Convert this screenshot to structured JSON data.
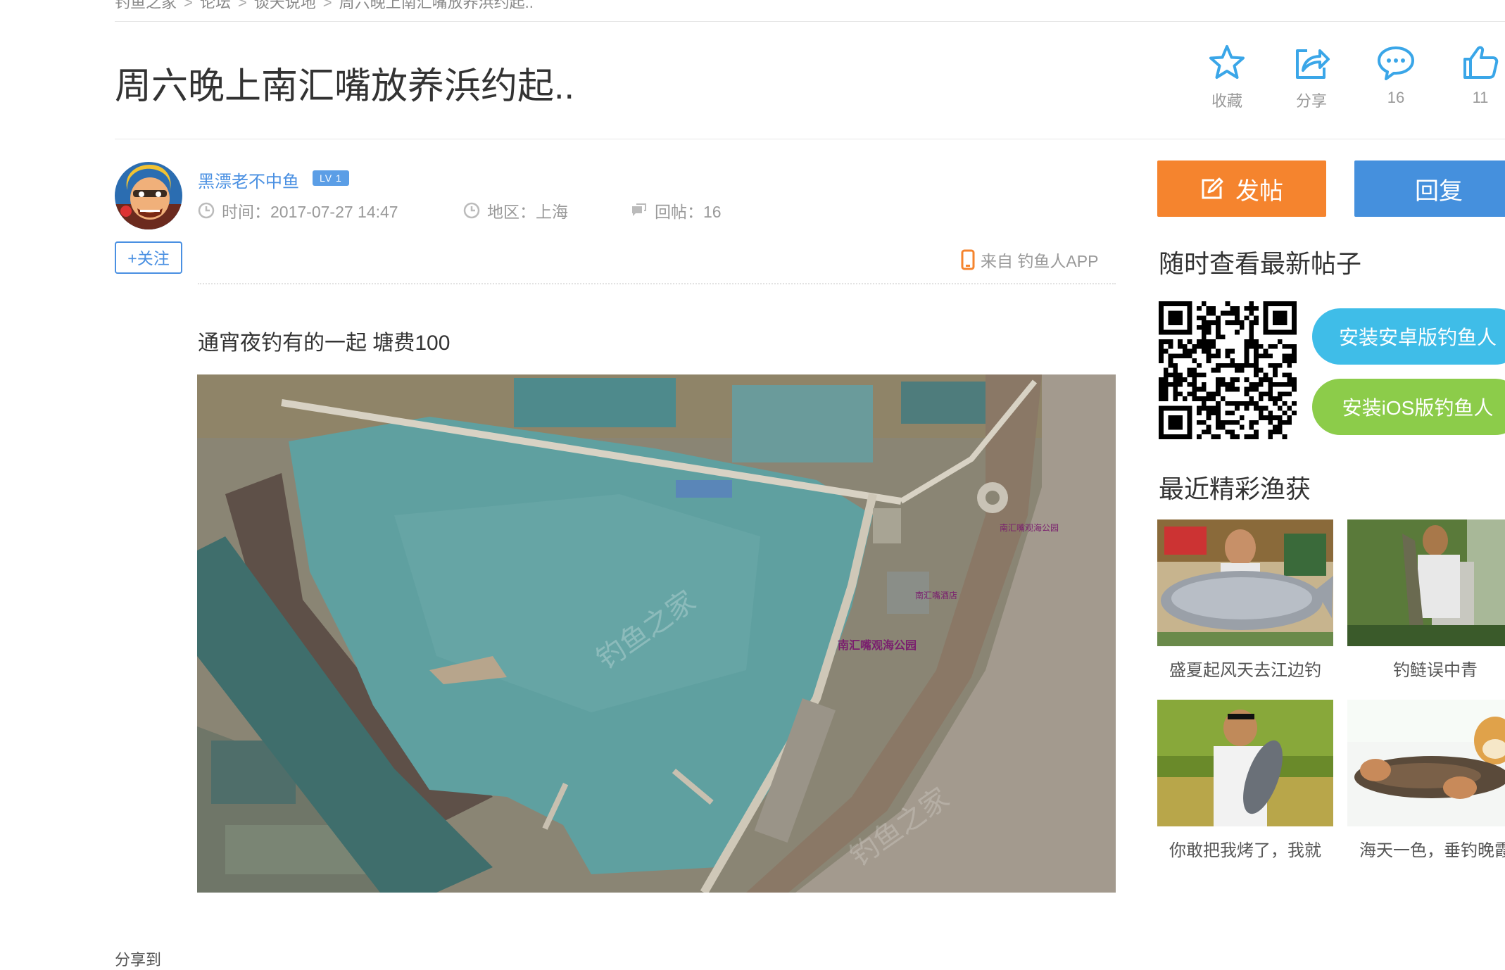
{
  "breadcrumb": [
    "钓鱼之家",
    "论坛",
    "谈天说地",
    "周六晚上南汇嘴放养浜约起.."
  ],
  "breadcrumb_sep": ">",
  "post": {
    "title": "周六晚上南汇嘴放养浜约起..",
    "author": "黑漂老不中鱼",
    "level": "LV 1",
    "time": "时间：2017-07-27 14:47",
    "region": "地区：上海",
    "replies": "回帖：16",
    "follow_label": "+关注",
    "source": "来自 钓鱼人APP",
    "body": "通宵夜钓有的一起 塘费100",
    "photo_labels": [
      "南汇嘴观海公园",
      "南汇嘴观海公园",
      "南汇嘴酒店"
    ]
  },
  "actions": {
    "favorite": "收藏",
    "share": "分享",
    "comments": "16",
    "likes": "11"
  },
  "share_to": "分享到",
  "sidebar": {
    "post_button": "发帖",
    "reply_button": "回复",
    "app_heading": "随时查看最新帖子",
    "android_button": "安装安卓版钓鱼人",
    "ios_button": "安装iOS版钓鱼人",
    "catches_heading": "最近精彩渔获",
    "catches": [
      {
        "caption": "盛夏起风天去江边钓"
      },
      {
        "caption": "钓鲢误中青"
      },
      {
        "caption": "你敢把我烤了，我就"
      },
      {
        "caption": "海天一色，垂钓晚霞"
      }
    ]
  },
  "colors": {
    "link_blue": "#4a90e2",
    "post_orange": "#f5842e",
    "reply_blue": "#4590dd",
    "android_cyan": "#3fbde8",
    "ios_green": "#8ccc4a"
  }
}
